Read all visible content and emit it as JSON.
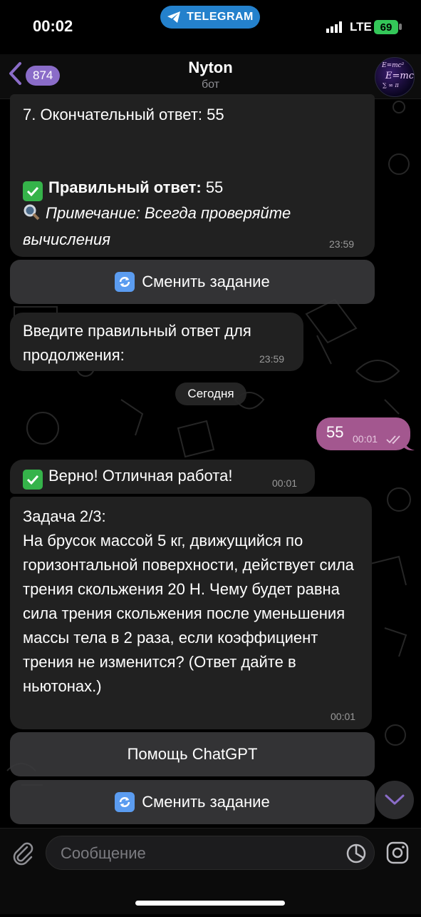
{
  "status_bar": {
    "time": "00:02",
    "pill_label": "TELEGRAM",
    "network": "LTE",
    "battery": "69"
  },
  "header": {
    "back_count": "874",
    "title": "Nyton",
    "subtitle": "бот"
  },
  "messages": {
    "m1": {
      "line_final": "7. Окончательный ответ: 55",
      "correct_label": "Правильный ответ:",
      "correct_value": " 55",
      "note": "Примечание: Всегда проверяйте вычисления",
      "time": "23:59"
    },
    "btn_change_1": "Сменить задание",
    "m2": {
      "text": "Введите правильный ответ для продолжения:",
      "time": "23:59"
    },
    "date_separator": "Сегодня",
    "out": {
      "text": "55",
      "time": "00:01"
    },
    "m3": {
      "text": "Верно! Отличная работа!",
      "time": "00:01"
    },
    "m4": {
      "title": "Задача 2/3:",
      "body": "На брусок массой 5 кг, движущийся по горизонтальной поверхности, действует сила трения скольжения 20 Н. Чему будет равна сила трения скольжения после уменьшения массы тела в 2 раза, если коэффициент трения не изменится? (Ответ дайте в ньютонах.)",
      "time": "00:01"
    },
    "btn_help": "Помощь ChatGPT",
    "btn_change_2": "Сменить задание"
  },
  "composer": {
    "placeholder": "Сообщение"
  },
  "colors": {
    "accent": "#8a6cc8",
    "outgoing": "#a3578f",
    "telegram": "#2481cc",
    "battery": "#34c759"
  }
}
